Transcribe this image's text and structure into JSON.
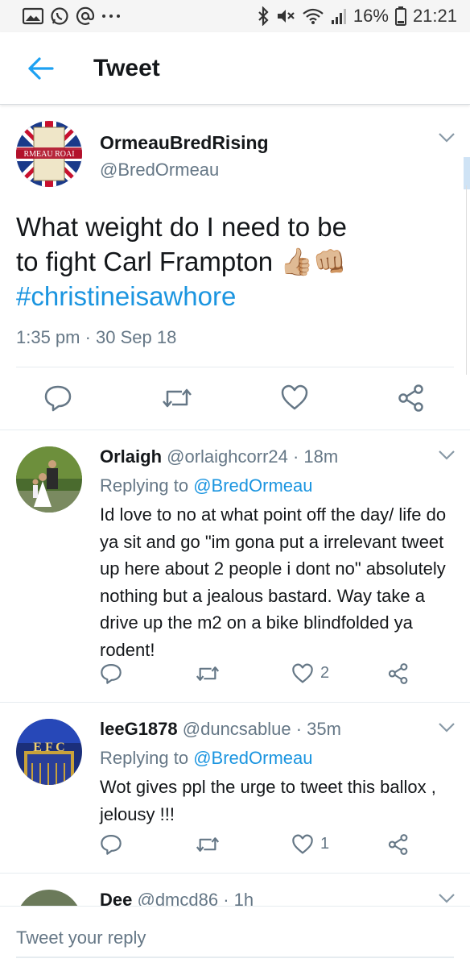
{
  "status_bar": {
    "battery": "16%",
    "time": "21:21",
    "left_icons": [
      "gallery-icon",
      "whatsapp-icon",
      "at-icon",
      "more-icon"
    ],
    "right_icons": [
      "bluetooth-icon",
      "mute-icon",
      "wifi-icon",
      "signal-icon",
      "battery-icon"
    ]
  },
  "app_bar": {
    "title": "Tweet"
  },
  "main_tweet": {
    "name": "OrmeauBredRising",
    "handle": "@BredOrmeau",
    "avatar_text": "RMEAU ROAI",
    "text_line1": "What weight do I need to be",
    "text_line2": "to fight Carl Frampton",
    "emoji": "👍🏼👊🏼",
    "hashtag": "#christineisawhore",
    "timestamp": "1:35 pm · 30 Sep 18"
  },
  "replies": [
    {
      "name": "Orlaigh",
      "meta": "@orlaighcorr24 · 18m",
      "replying_prefix": "Replying to",
      "replying_to": "@BredOrmeau",
      "body": "Id love to no at what point off the day/ life do ya sit and go \"im gona put a irrelevant tweet up here about 2 people i dont no\" absolutely nothing but a jealous bastard. Way take a drive up the m2 on a bike blindfolded ya rodent!",
      "like_count": "2"
    },
    {
      "name": "leeG1878",
      "meta": "@duncsablue · 35m",
      "replying_prefix": "Replying to",
      "replying_to": "@BredOrmeau",
      "body": "Wot gives ppl the urge to tweet this ballox , jelousy !!!",
      "like_count": "1",
      "avatar_text": "E F C"
    },
    {
      "name": "Dee",
      "meta": "@dmcd86 · 1h"
    }
  ],
  "reply_bar": {
    "placeholder": "Tweet your reply"
  },
  "colors": {
    "accent": "#1b95e0",
    "muted": "#657786",
    "text": "#14171a",
    "back_arrow": "#1da1f2"
  }
}
